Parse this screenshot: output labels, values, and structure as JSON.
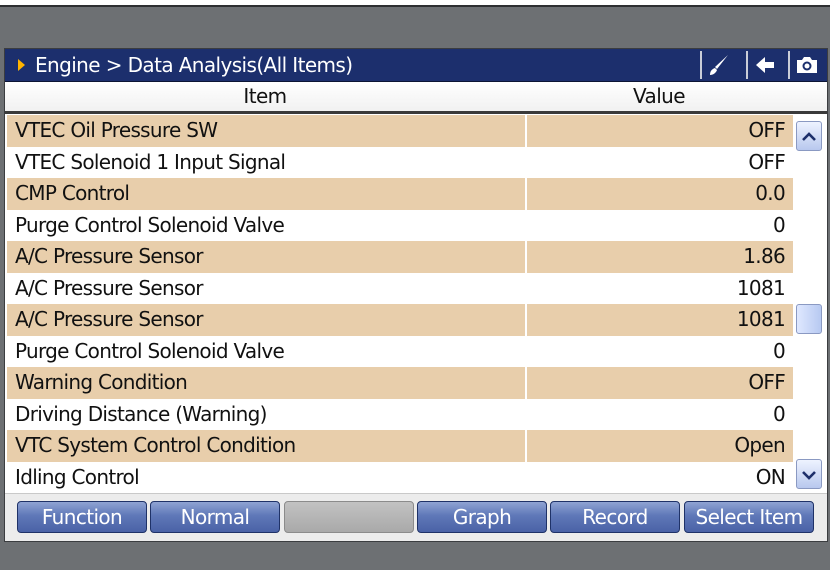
{
  "breadcrumb": "Engine > Data Analysis(All Items)",
  "toolbar": {
    "icons": [
      "brush-icon",
      "back-arrow-icon",
      "camera-icon"
    ]
  },
  "table": {
    "headers": {
      "item": "Item",
      "value": "Value"
    },
    "rows": [
      {
        "item": "VTEC Oil Pressure SW",
        "value": "OFF"
      },
      {
        "item": "VTEC Solenoid 1 Input Signal",
        "value": "OFF"
      },
      {
        "item": "CMP Control",
        "value": "0.0"
      },
      {
        "item": "Purge Control Solenoid Valve",
        "value": "0"
      },
      {
        "item": "A/C Pressure Sensor",
        "value": "1.86"
      },
      {
        "item": "A/C Pressure Sensor",
        "value": "1081"
      },
      {
        "item": "A/C Pressure Sensor",
        "value": "1081"
      },
      {
        "item": "Purge Control Solenoid Valve",
        "value": "0"
      },
      {
        "item": "Warning Condition",
        "value": "OFF"
      },
      {
        "item": "Driving Distance (Warning)",
        "value": "0"
      },
      {
        "item": "VTC System Control Condition",
        "value": "Open"
      },
      {
        "item": "Idling Control",
        "value": "ON"
      }
    ]
  },
  "scroll": {
    "position_fraction": 0.55
  },
  "footer": {
    "buttons": [
      {
        "label": "Function"
      },
      {
        "label": "Normal"
      },
      {
        "label": ""
      },
      {
        "label": "Graph"
      },
      {
        "label": "Record"
      },
      {
        "label": "Select Item"
      }
    ]
  },
  "colors": {
    "title_bar": "#1c2f6d",
    "row_highlight": "#e8ceab",
    "button_blue": "#5f78b8",
    "breadcrumb_arrow": "#ffb300"
  }
}
